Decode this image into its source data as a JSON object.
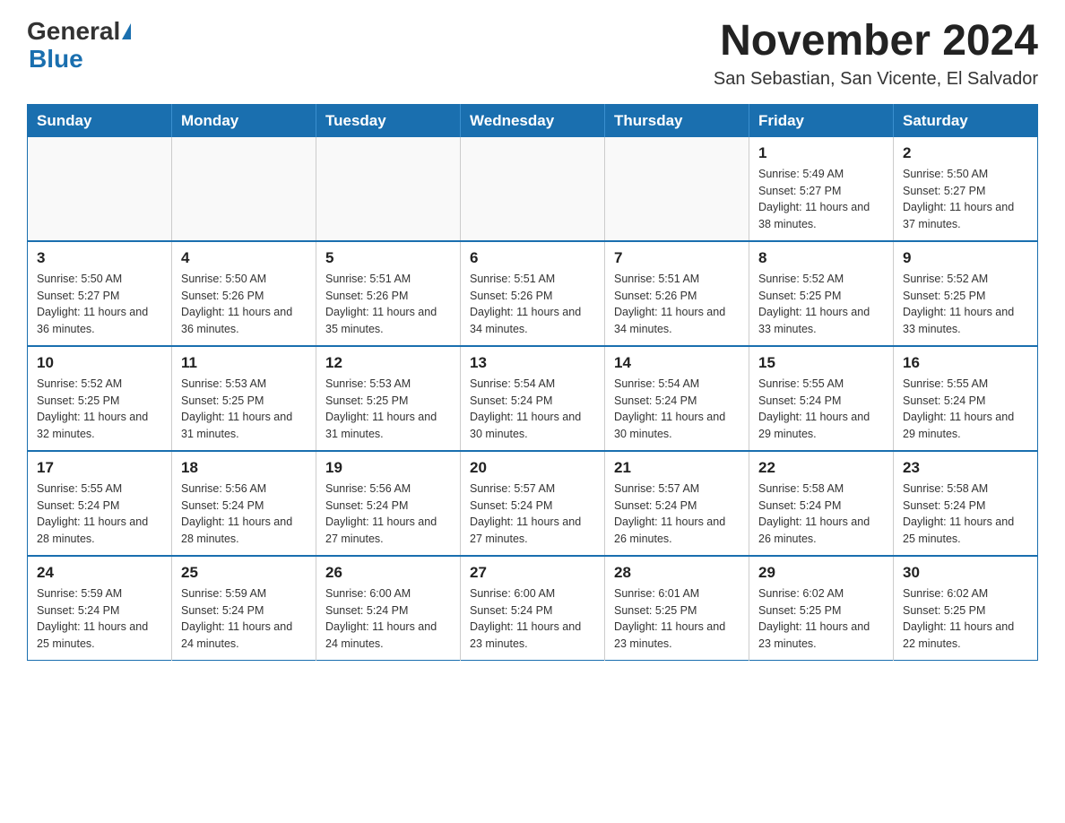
{
  "header": {
    "logo_general": "General",
    "logo_blue": "Blue",
    "title": "November 2024",
    "subtitle": "San Sebastian, San Vicente, El Salvador"
  },
  "calendar": {
    "days_of_week": [
      "Sunday",
      "Monday",
      "Tuesday",
      "Wednesday",
      "Thursday",
      "Friday",
      "Saturday"
    ],
    "weeks": [
      [
        {
          "day": "",
          "info": ""
        },
        {
          "day": "",
          "info": ""
        },
        {
          "day": "",
          "info": ""
        },
        {
          "day": "",
          "info": ""
        },
        {
          "day": "",
          "info": ""
        },
        {
          "day": "1",
          "info": "Sunrise: 5:49 AM\nSunset: 5:27 PM\nDaylight: 11 hours and 38 minutes."
        },
        {
          "day": "2",
          "info": "Sunrise: 5:50 AM\nSunset: 5:27 PM\nDaylight: 11 hours and 37 minutes."
        }
      ],
      [
        {
          "day": "3",
          "info": "Sunrise: 5:50 AM\nSunset: 5:27 PM\nDaylight: 11 hours and 36 minutes."
        },
        {
          "day": "4",
          "info": "Sunrise: 5:50 AM\nSunset: 5:26 PM\nDaylight: 11 hours and 36 minutes."
        },
        {
          "day": "5",
          "info": "Sunrise: 5:51 AM\nSunset: 5:26 PM\nDaylight: 11 hours and 35 minutes."
        },
        {
          "day": "6",
          "info": "Sunrise: 5:51 AM\nSunset: 5:26 PM\nDaylight: 11 hours and 34 minutes."
        },
        {
          "day": "7",
          "info": "Sunrise: 5:51 AM\nSunset: 5:26 PM\nDaylight: 11 hours and 34 minutes."
        },
        {
          "day": "8",
          "info": "Sunrise: 5:52 AM\nSunset: 5:25 PM\nDaylight: 11 hours and 33 minutes."
        },
        {
          "day": "9",
          "info": "Sunrise: 5:52 AM\nSunset: 5:25 PM\nDaylight: 11 hours and 33 minutes."
        }
      ],
      [
        {
          "day": "10",
          "info": "Sunrise: 5:52 AM\nSunset: 5:25 PM\nDaylight: 11 hours and 32 minutes."
        },
        {
          "day": "11",
          "info": "Sunrise: 5:53 AM\nSunset: 5:25 PM\nDaylight: 11 hours and 31 minutes."
        },
        {
          "day": "12",
          "info": "Sunrise: 5:53 AM\nSunset: 5:25 PM\nDaylight: 11 hours and 31 minutes."
        },
        {
          "day": "13",
          "info": "Sunrise: 5:54 AM\nSunset: 5:24 PM\nDaylight: 11 hours and 30 minutes."
        },
        {
          "day": "14",
          "info": "Sunrise: 5:54 AM\nSunset: 5:24 PM\nDaylight: 11 hours and 30 minutes."
        },
        {
          "day": "15",
          "info": "Sunrise: 5:55 AM\nSunset: 5:24 PM\nDaylight: 11 hours and 29 minutes."
        },
        {
          "day": "16",
          "info": "Sunrise: 5:55 AM\nSunset: 5:24 PM\nDaylight: 11 hours and 29 minutes."
        }
      ],
      [
        {
          "day": "17",
          "info": "Sunrise: 5:55 AM\nSunset: 5:24 PM\nDaylight: 11 hours and 28 minutes."
        },
        {
          "day": "18",
          "info": "Sunrise: 5:56 AM\nSunset: 5:24 PM\nDaylight: 11 hours and 28 minutes."
        },
        {
          "day": "19",
          "info": "Sunrise: 5:56 AM\nSunset: 5:24 PM\nDaylight: 11 hours and 27 minutes."
        },
        {
          "day": "20",
          "info": "Sunrise: 5:57 AM\nSunset: 5:24 PM\nDaylight: 11 hours and 27 minutes."
        },
        {
          "day": "21",
          "info": "Sunrise: 5:57 AM\nSunset: 5:24 PM\nDaylight: 11 hours and 26 minutes."
        },
        {
          "day": "22",
          "info": "Sunrise: 5:58 AM\nSunset: 5:24 PM\nDaylight: 11 hours and 26 minutes."
        },
        {
          "day": "23",
          "info": "Sunrise: 5:58 AM\nSunset: 5:24 PM\nDaylight: 11 hours and 25 minutes."
        }
      ],
      [
        {
          "day": "24",
          "info": "Sunrise: 5:59 AM\nSunset: 5:24 PM\nDaylight: 11 hours and 25 minutes."
        },
        {
          "day": "25",
          "info": "Sunrise: 5:59 AM\nSunset: 5:24 PM\nDaylight: 11 hours and 24 minutes."
        },
        {
          "day": "26",
          "info": "Sunrise: 6:00 AM\nSunset: 5:24 PM\nDaylight: 11 hours and 24 minutes."
        },
        {
          "day": "27",
          "info": "Sunrise: 6:00 AM\nSunset: 5:24 PM\nDaylight: 11 hours and 23 minutes."
        },
        {
          "day": "28",
          "info": "Sunrise: 6:01 AM\nSunset: 5:25 PM\nDaylight: 11 hours and 23 minutes."
        },
        {
          "day": "29",
          "info": "Sunrise: 6:02 AM\nSunset: 5:25 PM\nDaylight: 11 hours and 23 minutes."
        },
        {
          "day": "30",
          "info": "Sunrise: 6:02 AM\nSunset: 5:25 PM\nDaylight: 11 hours and 22 minutes."
        }
      ]
    ]
  }
}
